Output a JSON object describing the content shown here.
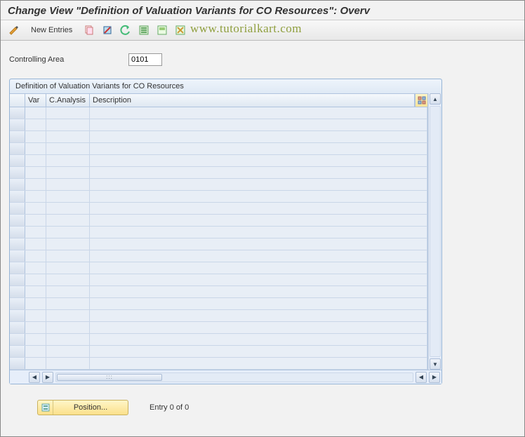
{
  "title": "Change View \"Definition of Valuation Variants for CO Resources\": Overv",
  "watermark": "www.tutorialkart.com",
  "toolbar": {
    "new_entries_label": "New Entries"
  },
  "field": {
    "controlling_area_label": "Controlling Area",
    "controlling_area_value": "0101"
  },
  "panel": {
    "title": "Definition of Valuation Variants for CO Resources",
    "columns": {
      "var": "Var",
      "canalysis": "C.Analysis",
      "description": "Description"
    }
  },
  "footer": {
    "position_label": "Position...",
    "entry_status": "Entry 0 of 0"
  },
  "hscroll_thumb_label": ":::"
}
